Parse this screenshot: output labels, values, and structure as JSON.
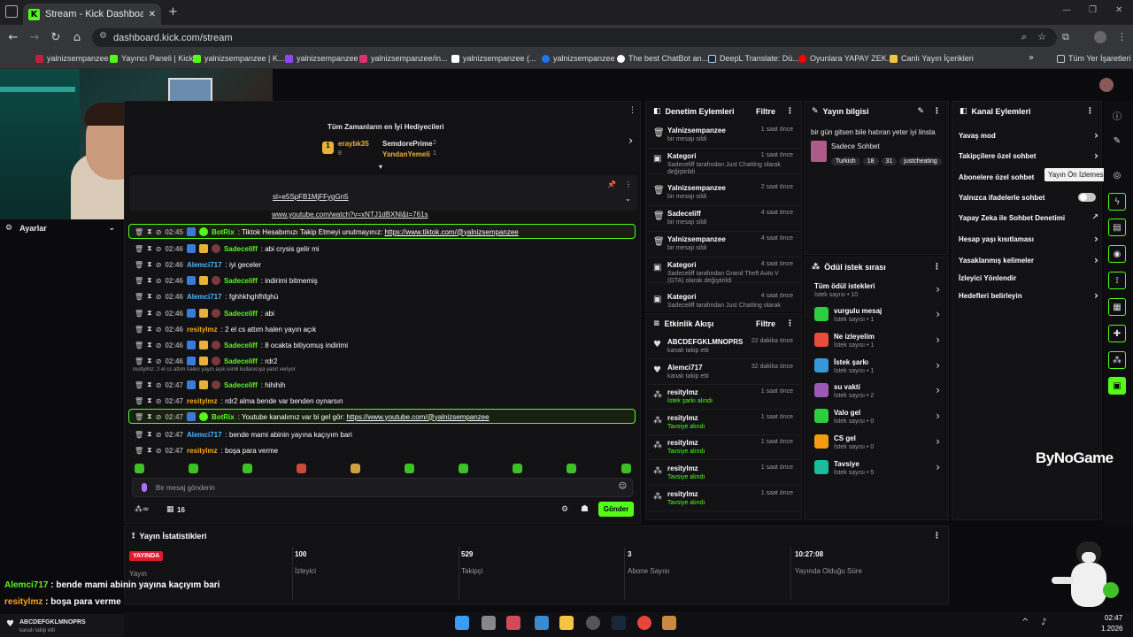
{
  "browser": {
    "tab_title": "Stream - Kick Dashboard",
    "new_tab": "+",
    "url": "dashboard.kick.com/stream",
    "bookmarks": [
      {
        "label": "yalnizsempanzee",
        "color": "#c02040"
      },
      {
        "label": "Yayıncı Paneli | Kick",
        "color": "#53fc18"
      },
      {
        "label": "yalnizsempanzee | K...",
        "color": "#53fc18"
      },
      {
        "label": "yalnizsempanzee",
        "color": "#9146ff"
      },
      {
        "label": "yalnizsempanzee/in...",
        "color": "#e1306c"
      },
      {
        "label": "yalnizsempanzee (...",
        "color": "#ffffff"
      },
      {
        "label": "yalnizsempanzee",
        "color": "#1877f2"
      },
      {
        "label": "The best ChatBot an...",
        "color": "#ffffff"
      },
      {
        "label": "DeepL Translate: Dü...",
        "color": "#0f2b46"
      },
      {
        "label": "Oyunlara YAPAY ZEK...",
        "color": "#ff0000"
      },
      {
        "label": "Canlı Yayın İçerikleri",
        "color": "#f5c542"
      }
    ],
    "all_bookmarks": "Tüm Yer İşaretleri"
  },
  "sidebar": {
    "settings": "Ayarlar"
  },
  "top_gifters": {
    "title": "Tüm Zamanların en İyi Hediyecileri",
    "first": {
      "name": "eraybk35",
      "count": "8"
    },
    "second": {
      "name": "SemdorePrime",
      "count": "2"
    },
    "third": {
      "name": "YandanYemeli",
      "count": "1"
    }
  },
  "pinned": {
    "line1": "sl=e5SpFB1MjFFygGn5",
    "line2": "www.youtube.com/watch?v=xNTJ1dBXNl&t=761s"
  },
  "chat": [
    {
      "time": "02:45",
      "user": "BotRix",
      "color": "#53fc18",
      "msg": ": Tiktok Hesabımızı Takip Etmeyi unutmayınız: ",
      "link": "https://www.tiktok.com/@yalnizsempanzee",
      "highlight": true
    },
    {
      "time": "02:46",
      "user": "Sadeceliff",
      "color": "#53fc18",
      "msg": ": abi crysis gelir mi"
    },
    {
      "time": "02:46",
      "user": "Alemci717",
      "color": "#4fb6ff",
      "msg": ": iyi geceler"
    },
    {
      "time": "02:46",
      "user": "Sadeceliff",
      "color": "#53fc18",
      "msg": ": indirimi bitmemiş"
    },
    {
      "time": "02:46",
      "user": "Alemci717",
      "color": "#4fb6ff",
      "msg": ": fghhkhghfhfghü"
    },
    {
      "time": "02:46",
      "user": "Sadeceliff",
      "color": "#53fc18",
      "msg": ": abi"
    },
    {
      "time": "02:46",
      "user": "resitylmz",
      "color": "#f5a623",
      "msg": ": 2 el cs attım halen yayın açık"
    },
    {
      "time": "02:46",
      "user": "Sadeceliff",
      "color": "#53fc18",
      "msg": ": 8 ocakta bitiyomuş indirimi"
    },
    {
      "time": "02:46",
      "user": "Sadeceliff",
      "color": "#53fc18",
      "msg": ": rdr2"
    },
    {
      "time": "02:47",
      "user": "Sadeceliff",
      "color": "#53fc18",
      "msg": ": hihihih",
      "reply": "resitylmz: 2 el cs attım halen yayın açık isimli kullanıcıya yanıt veriyor"
    },
    {
      "time": "02:47",
      "user": "resitylmz",
      "color": "#f5a623",
      "msg": ": rdr2 alma bende var benden oynarsın"
    },
    {
      "time": "02:47",
      "user": "BotRix",
      "color": "#53fc18",
      "msg": ": Youtube kanalımız var bi gel gör: ",
      "link": "https://www.youtube.com/@yalnizsempanzee",
      "highlight": true
    },
    {
      "time": "02:47",
      "user": "Alemci717",
      "color": "#4fb6ff",
      "msg": ": bende mami abinin yayına kaçıyım bari"
    },
    {
      "time": "02:47",
      "user": "resitylmz",
      "color": "#f5a623",
      "msg": ": boşa para verme"
    }
  ],
  "chat_input": {
    "placeholder": "Bir mesaj gönderin",
    "viewers_count": "16",
    "send": "Gönder"
  },
  "mod_actions": {
    "title": "Denetim Eylemleri",
    "filter": "Filtre",
    "rows": [
      {
        "title": "Yalnizsempanzee",
        "sub": "bir mesajı sildi",
        "time": "1 saat önce"
      },
      {
        "title": "Kategori",
        "sub": "Sadeceliff tarafından Just Chatting olarak değiştirildi",
        "time": "1 saat önce"
      },
      {
        "title": "Yalnizsempanzee",
        "sub": "bir mesajı sildi",
        "time": "2 saat önce"
      },
      {
        "title": "Sadeceliff",
        "sub": "bir mesajı sildi",
        "time": "4 saat önce"
      },
      {
        "title": "Yalnizsempanzee",
        "sub": "bir mesajı sildi",
        "time": "4 saat önce"
      },
      {
        "title": "Kategori",
        "sub": "Sadeceliff tarafından Grand Theft Auto V (GTA) olarak değiştirildi",
        "time": "4 saat önce"
      },
      {
        "title": "Kategori",
        "sub": "Sadeceliff tarafından Just Chatting olarak",
        "time": "4 saat önce"
      }
    ]
  },
  "activity": {
    "title": "Etkinlik Akışı",
    "filter": "Filtre",
    "rows": [
      {
        "title": "ABCDEFGKLMNOPRS",
        "sub": "kanalı takip etti",
        "time": "22 dakika önce"
      },
      {
        "title": "Alemci717",
        "sub": "kanalı takip etti",
        "time": "32 dakika önce"
      },
      {
        "title": "resitylmz",
        "sub": "İstek şarkı alındı",
        "time": "1 saat önce"
      },
      {
        "title": "resitylmz",
        "sub": "Tavsiye alındı",
        "time": "1 saat önce"
      },
      {
        "title": "resitylmz",
        "sub": "Tavsiye alındı",
        "time": "1 saat önce"
      },
      {
        "title": "resitylmz",
        "sub": "Tavsiye alındı",
        "time": "1 saat önce"
      },
      {
        "title": "resitylmz",
        "sub": "Tavsiye alındı",
        "time": "1 saat önce"
      }
    ]
  },
  "stream_info": {
    "title": "Yayın bilgisi",
    "stream_title": "bir gün gitsen bile hatıran yeter iyi linsta",
    "category": "Sadece Sohbet",
    "tags": [
      "Turkish",
      "18",
      "31",
      "justcheating"
    ]
  },
  "rewards": {
    "title": "Ödül istek sırası",
    "all": {
      "title": "Tüm ödül istekleri",
      "sub": "İstek sayısı • 10"
    },
    "items": [
      {
        "title": "vurgulu mesaj",
        "sub": "İstek sayısı • 1",
        "color": "#2ecc40"
      },
      {
        "title": "Ne izleyelim",
        "sub": "İstek sayısı • 1",
        "color": "#e74c3c"
      },
      {
        "title": "İstek şarkı",
        "sub": "İstek sayısı • 1",
        "color": "#3498db"
      },
      {
        "title": "su vakti",
        "sub": "İstek sayısı • 2",
        "color": "#9b59b6"
      },
      {
        "title": "Valo gel",
        "sub": "İstek sayısı • 0",
        "color": "#2ecc40"
      },
      {
        "title": "CS gel",
        "sub": "İstek sayısı • 0",
        "color": "#f39c12"
      },
      {
        "title": "Tavsiye",
        "sub": "İstek sayısı • 5",
        "color": "#1abc9c"
      }
    ]
  },
  "channel_actions": {
    "title": "Kanal Eylemleri",
    "tooltip": "Yayın Ön İzlemesi",
    "items": [
      "Yavaş mod",
      "Takipçilere özel sohbet",
      "Abonelere özel sohbet",
      "Yalnızca ifadelerle sohbet",
      "Yapay Zeka ile Sohbet Denetimi",
      "Hesap yaşı kısıtlaması",
      "Yasaklanmış kelimeler",
      "İzleyici Yönlendir",
      "Hedefleri belirleyin"
    ]
  },
  "watermark": "ByNoGame",
  "stats": {
    "title": "Yayın İstatistikleri",
    "live": "YAYINDA",
    "items": [
      {
        "value": "",
        "label": "Yayın"
      },
      {
        "value": "100",
        "label": "İzleyici"
      },
      {
        "value": "529",
        "label": "Takipçi"
      },
      {
        "value": "3",
        "label": "Abone Sayısı"
      },
      {
        "value": "10:27:08",
        "label": "Yayında Olduğu Süre"
      }
    ]
  },
  "overlay_chat": [
    {
      "user": "Alemci717",
      "msg": " : bende mami abinin yayına kaçıyım bari",
      "color": "#53fc18"
    },
    {
      "user": "resitylmz",
      "msg": " : boşa para verme",
      "color": "#f5a623"
    }
  ],
  "alert": {
    "name": "ABCDEFGKLMNOPRS",
    "sub": "kanalı takip etti"
  },
  "taskbar": {
    "time": "02:47",
    "date": "1.2026"
  }
}
